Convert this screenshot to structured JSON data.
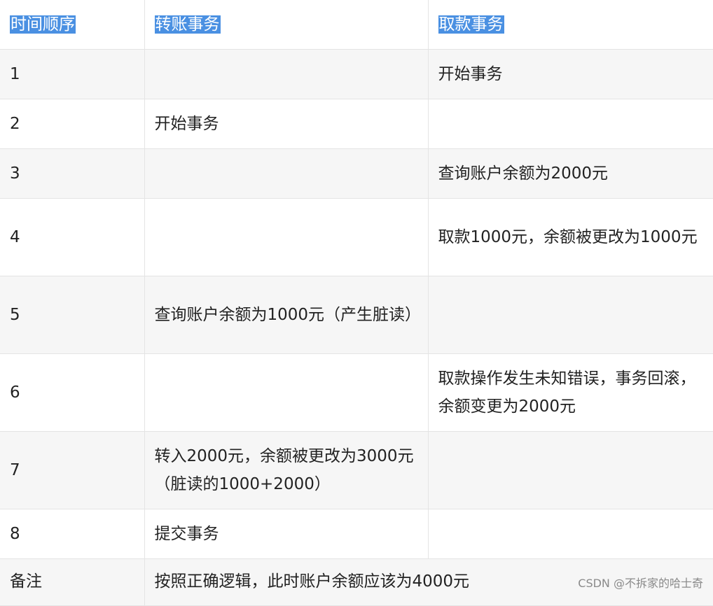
{
  "headers": [
    "时间顺序",
    "转账事务",
    "取款事务"
  ],
  "rows": [
    {
      "order": "1",
      "transfer": "",
      "withdraw": "开始事务"
    },
    {
      "order": "2",
      "transfer": "开始事务",
      "withdraw": ""
    },
    {
      "order": "3",
      "transfer": "",
      "withdraw": "查询账户余额为2000元"
    },
    {
      "order": "4",
      "transfer": "",
      "withdraw": "取款1000元，余额被更改为1000元"
    },
    {
      "order": "5",
      "transfer": "查询账户余额为1000元（产生脏读）",
      "withdraw": ""
    },
    {
      "order": "6",
      "transfer": "",
      "withdraw": "取款操作发生未知错误，事务回滚，余额变更为2000元"
    },
    {
      "order": "7",
      "transfer": "转入2000元，余额被更改为3000元（脏读的1000+2000）",
      "withdraw": ""
    },
    {
      "order": "8",
      "transfer": "提交事务",
      "withdraw": ""
    }
  ],
  "footer": {
    "label": "备注",
    "text": "按照正确逻辑，此时账户余额应该为4000元"
  },
  "watermark": "CSDN @不拆家的哈士奇"
}
